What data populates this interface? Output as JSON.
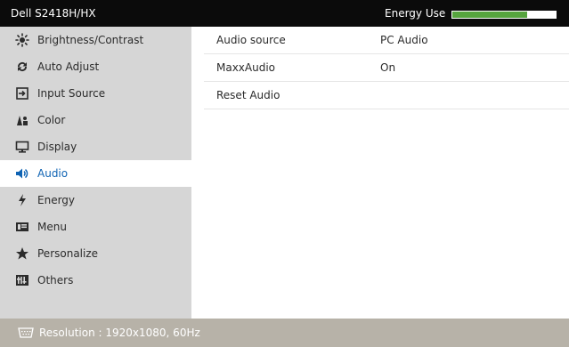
{
  "header": {
    "model": "Dell S2418H/HX",
    "energy_label": "Energy Use",
    "energy_level": 0.72,
    "energy_color": "#56a43e"
  },
  "sidebar": {
    "items": [
      {
        "label": "Brightness/Contrast",
        "icon": "brightness-icon"
      },
      {
        "label": "Auto Adjust",
        "icon": "auto-adjust-icon"
      },
      {
        "label": "Input Source",
        "icon": "input-source-icon"
      },
      {
        "label": "Color",
        "icon": "color-icon"
      },
      {
        "label": "Display",
        "icon": "display-icon"
      },
      {
        "label": "Audio",
        "icon": "speaker-icon",
        "active": true
      },
      {
        "label": "Energy",
        "icon": "energy-icon"
      },
      {
        "label": "Menu",
        "icon": "menu-icon"
      },
      {
        "label": "Personalize",
        "icon": "star-icon"
      },
      {
        "label": "Others",
        "icon": "others-icon"
      }
    ]
  },
  "content": {
    "rows": [
      {
        "label": "Audio source",
        "value": "PC Audio"
      },
      {
        "label": "MaxxAudio",
        "value": "On"
      },
      {
        "label": "Reset Audio",
        "value": ""
      }
    ]
  },
  "status": {
    "resolution": "Resolution : 1920x1080, 60Hz",
    "icon": "monitor-connector-icon"
  },
  "colors": {
    "accent": "#0f63b3",
    "sidebar_bg": "#d6d6d6",
    "titlebar_bg": "#0b0b0b",
    "statusbar_bg": "#b7b2a8"
  }
}
